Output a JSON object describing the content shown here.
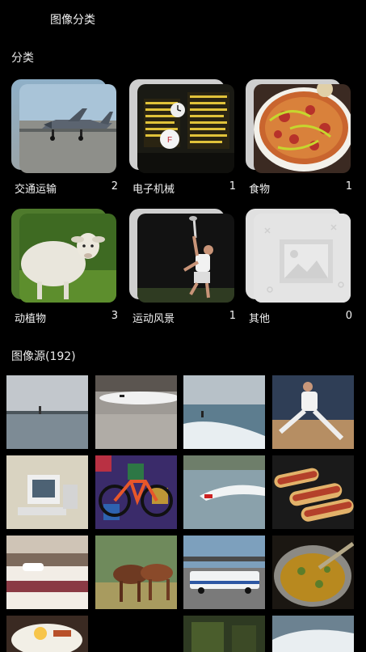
{
  "app": {
    "title": "图像分类"
  },
  "categories_section": {
    "title": "分类"
  },
  "categories": [
    {
      "name": "交通运输",
      "count": "2"
    },
    {
      "name": "电子机械",
      "count": "1"
    },
    {
      "name": "食物",
      "count": "1"
    },
    {
      "name": "动植物",
      "count": "3"
    },
    {
      "name": "运动风景",
      "count": "1"
    },
    {
      "name": "其他",
      "count": "0"
    }
  ],
  "sources_section": {
    "title": "图像源(192)"
  }
}
